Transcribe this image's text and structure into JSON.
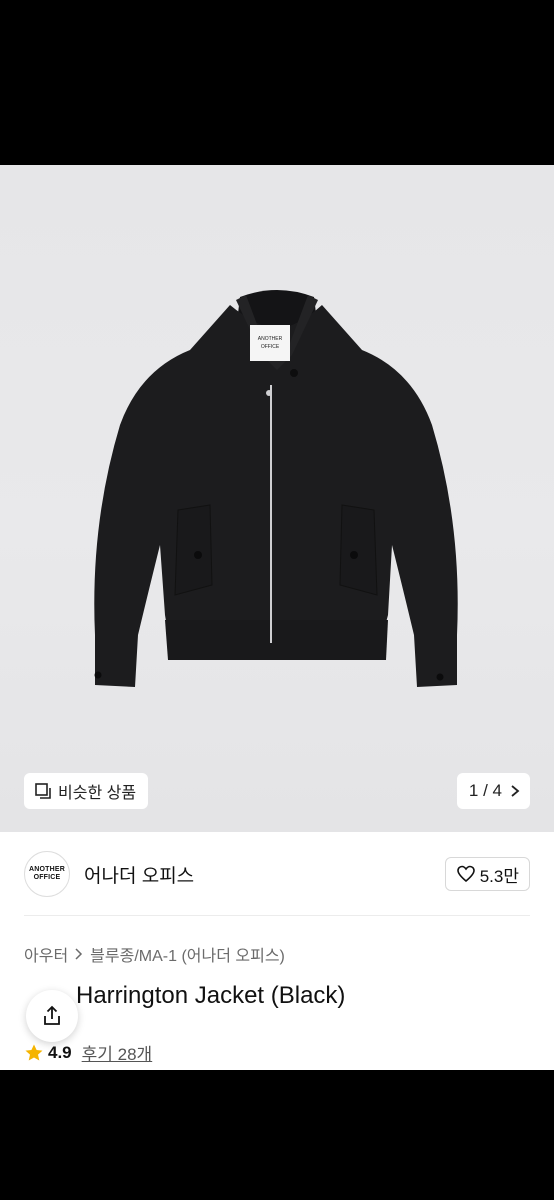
{
  "hero": {
    "label_brand_line1": "ANOTHER",
    "label_brand_line2": "OFFICE",
    "similar_label": "비슷한 상품",
    "pager_text": "1 / 4"
  },
  "brand": {
    "logo_line1": "ANOTHER",
    "logo_line2": "OFFICE",
    "name": "어나더 오피스",
    "likes": "5.3만"
  },
  "breadcrumb": {
    "category": "아우터",
    "subcategory": "블루종/MA-1 (어나더 오피스)"
  },
  "product": {
    "title": "Harrington Jacket (Black)",
    "rating": "4.9",
    "reviews": "후기 28개"
  },
  "colors": {
    "star": "#f5b400",
    "jacket": "#1c1c1e",
    "hero_bg": "#e8e8ea"
  },
  "icons": {
    "similar": "square-stack-icon",
    "pager_next": "chevron-right-icon",
    "like": "heart-icon",
    "share": "share-icon",
    "breadcrumb_sep": "chevron-right-icon",
    "star": "star-icon"
  }
}
